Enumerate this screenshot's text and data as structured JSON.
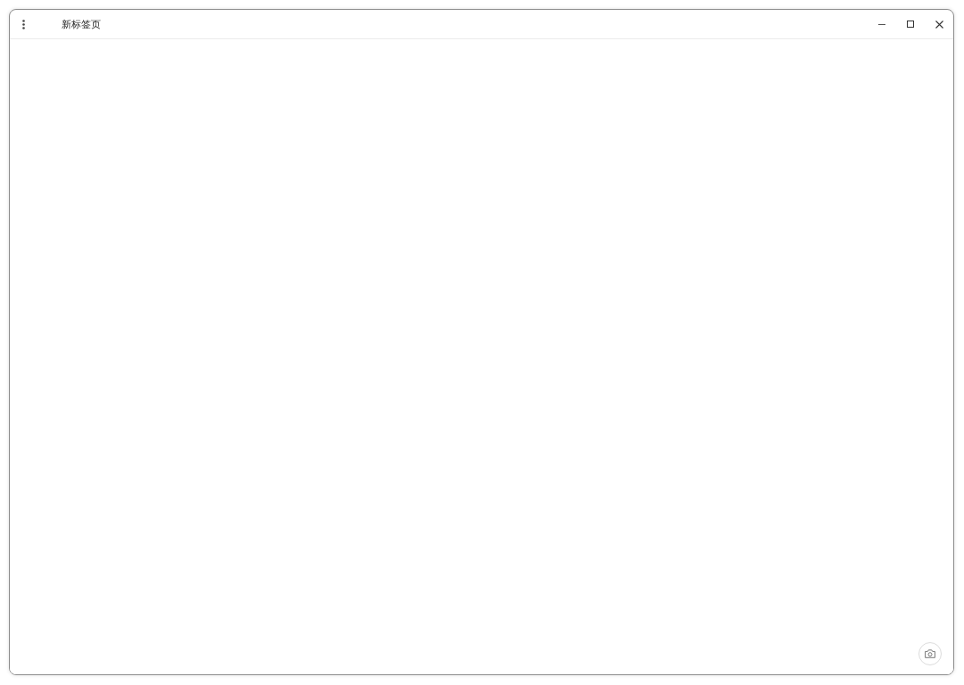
{
  "window": {
    "title": "新标签页"
  }
}
